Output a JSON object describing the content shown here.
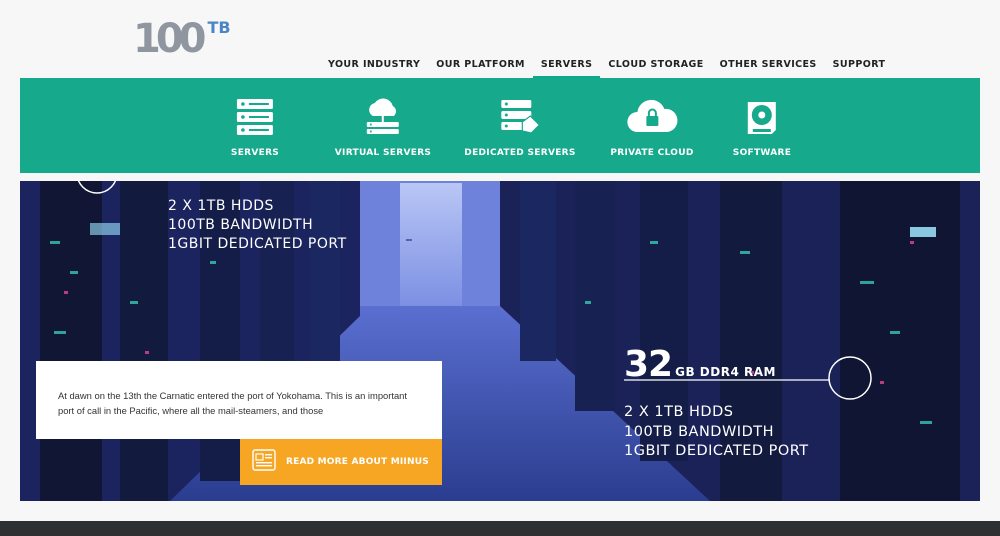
{
  "logo": {
    "main": "100",
    "suffix": "TB"
  },
  "nav": {
    "items": [
      {
        "label": "YOUR INDUSTRY",
        "active": false
      },
      {
        "label": "OUR PLATFORM",
        "active": false
      },
      {
        "label": "SERVERS",
        "active": true
      },
      {
        "label": "CLOUD STORAGE",
        "active": false
      },
      {
        "label": "OTHER SERVICES",
        "active": false
      },
      {
        "label": "SUPPORT",
        "active": false
      }
    ]
  },
  "subnav": {
    "items": [
      {
        "label": "SERVERS",
        "icon": "server-stack-icon"
      },
      {
        "label": "VIRTUAL SERVERS",
        "icon": "cloud-network-icon"
      },
      {
        "label": "DEDICATED SERVERS",
        "icon": "dedicated-server-icon"
      },
      {
        "label": "PRIVATE CLOUD",
        "icon": "cloud-lock-icon"
      },
      {
        "label": "SOFTWARE",
        "icon": "software-disc-icon"
      }
    ]
  },
  "hero": {
    "spec_top": {
      "line1": "2 X 1TB HDDS",
      "line2": "100TB BANDWIDTH",
      "line3": "1GBIT DEDICATED PORT"
    },
    "ram": {
      "number": "32",
      "label": "GB DDR4 RAM"
    },
    "spec_bottom": {
      "line1": "2 X 1TB HDDS",
      "line2": "100TB BANDWIDTH",
      "line3": "1GBIT DEDICATED PORT"
    },
    "callout_text": "At dawn on the 13th the Carnatic entered the port of Yokohama.  This is an important port of call in the Pacific, where all the mail-steamers, and those",
    "read_more_label": "READ MORE ABOUT MIINUS"
  },
  "colors": {
    "brand_green": "#16a98b",
    "accent_orange": "#f6a623",
    "logo_gray": "#8f96a0",
    "logo_blue": "#4a86c5",
    "footer": "#2f3032"
  }
}
